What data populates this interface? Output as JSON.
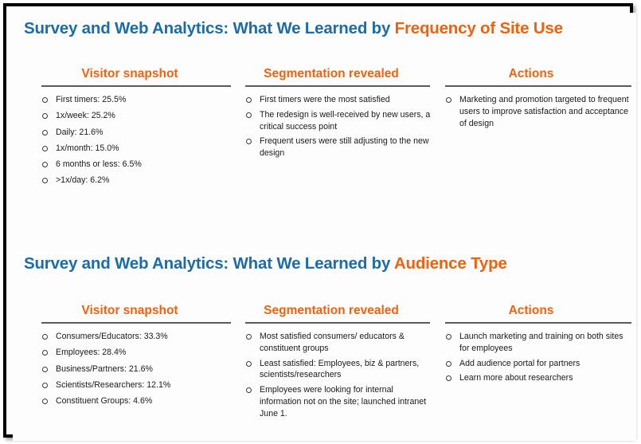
{
  "slide": {
    "background_color": "#fdfdfd",
    "border_color": "#000000",
    "accent_blue": "#1a6cab",
    "accent_orange": "#f4610d",
    "rule_color": "#5b5b5b",
    "bullet_marker": "open-circle"
  },
  "sections": [
    {
      "title_prefix": "Survey and Web Analytics: What We Learned by ",
      "title_highlight": "Frequency of Site Use",
      "columns": [
        {
          "heading": "Visitor snapshot",
          "items": [
            "First timers: 25.5%",
            "1x/week: 25.2%",
            "Daily: 21.6%",
            "1x/month: 15.0%",
            "6 months or less: 6.5%",
            ">1x/day: 6.2%"
          ]
        },
        {
          "heading": "Segmentation revealed",
          "items": [
            "First timers were the most satisfied",
            "The redesign is well-received by new users, a critical success point",
            "Frequent users were still adjusting to the new design"
          ]
        },
        {
          "heading": "Actions",
          "items": [
            "Marketing and promotion targeted to frequent users to improve satisfaction and acceptance of design"
          ]
        }
      ]
    },
    {
      "title_prefix": "Survey and Web Analytics: What We Learned by ",
      "title_highlight": "Audience Type",
      "columns": [
        {
          "heading": "Visitor snapshot",
          "items": [
            "Consumers/Educators: 33.3%",
            "Employees: 28.4%",
            "Business/Partners: 21.6%",
            "Scientists/Researchers: 12.1%",
            "Constituent Groups: 4.6%"
          ]
        },
        {
          "heading": "Segmentation revealed",
          "items": [
            "Most satisfied consumers/ educators & constituent groups",
            "Least satisfied: Employees, biz & partners, scientists/researchers",
            "Employees were looking for internal information not on the site; launched intranet June 1."
          ]
        },
        {
          "heading": "Actions",
          "items": [
            "Launch marketing and training on both sites for employees",
            "Add audience portal for partners",
            "Learn more about researchers"
          ]
        }
      ]
    }
  ],
  "chart_data": {
    "type": "table",
    "title": "Survey and Web Analytics: What We Learned",
    "datasets": [
      {
        "name": "Frequency of Site Use",
        "categories": [
          "First timers",
          "1x/week",
          "Daily",
          "1x/month",
          "6 months or less",
          ">1x/day"
        ],
        "values": [
          25.5,
          25.2,
          21.6,
          15.0,
          6.5,
          6.2
        ],
        "unit": "%"
      },
      {
        "name": "Audience Type",
        "categories": [
          "Consumers/Educators",
          "Employees",
          "Business/Partners",
          "Scientists/Researchers",
          "Constituent Groups"
        ],
        "values": [
          33.3,
          28.4,
          21.6,
          12.1,
          4.6
        ],
        "unit": "%"
      }
    ]
  }
}
